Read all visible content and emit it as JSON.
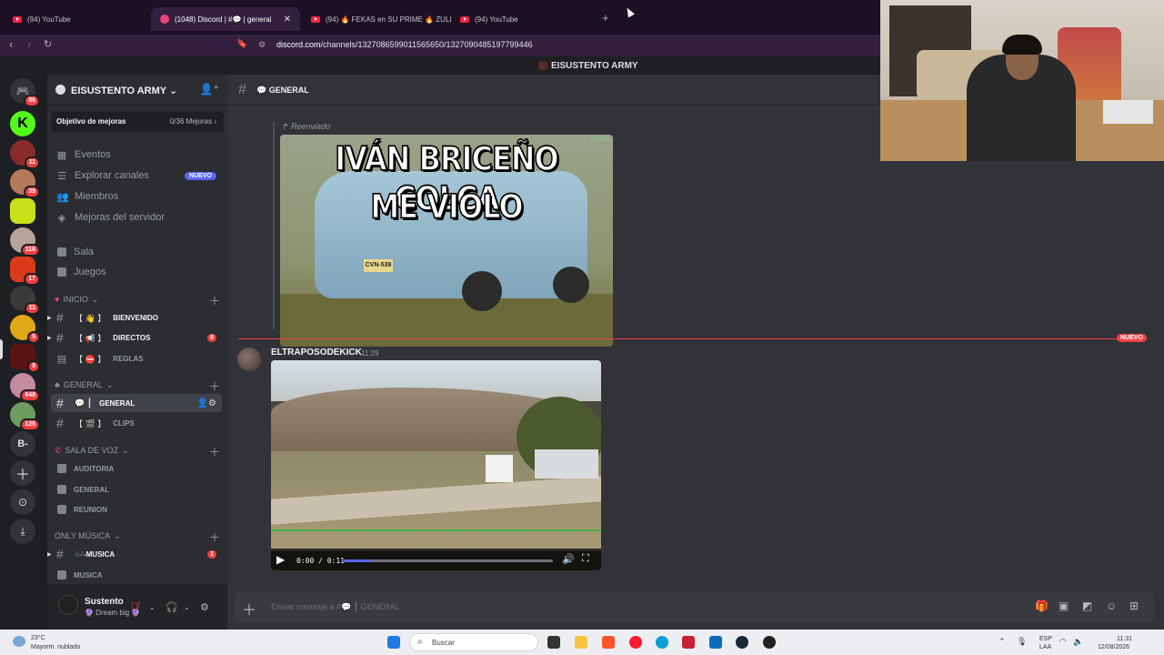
{
  "browser": {
    "tabs": [
      {
        "title": "(94) YouTube",
        "kind": "youtube"
      },
      {
        "title": "(1048) Discord | #💬 | general | E",
        "kind": "discord",
        "active": true
      },
      {
        "title": "(94) 🔥 FEKAS en SU PRIME 🔥 ZULLY",
        "kind": "youtube"
      },
      {
        "title": "(94) YouTube",
        "kind": "youtube"
      }
    ],
    "new_tab": "+",
    "url_host": "discord.com",
    "url_path": "/channels/1327086599011565650/1327090485197799446"
  },
  "discord": {
    "window_title": "EISUSTENTO ARMY",
    "guild_badges": [
      "86",
      "11",
      "39",
      "118",
      "17",
      "11",
      "5",
      "9",
      "648",
      "125"
    ],
    "guild_text": "B-",
    "server": {
      "name": "EISUSTENTO ARMY",
      "boost_label": "Objetivo de mejoras",
      "boost_value": "0/36 Mejoras",
      "menu": [
        {
          "label": "Eventos",
          "icon": "calendar-icon"
        },
        {
          "label": "Explorar canales",
          "icon": "browse-icon",
          "badge": "NUEVO"
        },
        {
          "label": "Miembros",
          "icon": "members-icon"
        },
        {
          "label": "Mejoras del servidor",
          "icon": "boost-icon"
        }
      ],
      "voice_top": [
        "Sala",
        "Juegos"
      ],
      "categories": {
        "inicio": "INICIO",
        "general": "GENERAL",
        "voz": "SALA DE VOZ",
        "musica": "ONLY MÚSICA"
      },
      "inicio_channels": [
        {
          "name": "bienvenido",
          "bracket": "【 👋 】",
          "type": "text"
        },
        {
          "name": "directos",
          "bracket": "【 📢 】",
          "type": "text",
          "badge": "8"
        },
        {
          "name": "reglas",
          "bracket": "【 ⛔ 】",
          "type": "rules"
        }
      ],
      "general_channels": [
        {
          "name": "general",
          "bracket": "💬 ┃",
          "selected": true
        },
        {
          "name": "clips",
          "bracket": "【 🎬 】"
        }
      ],
      "voice_channels": [
        "AUDITORIA",
        "GENERAL",
        "REUNION"
      ],
      "music_channels": [
        {
          "name": "🎶-musica",
          "badge": "1",
          "type": "text"
        },
        {
          "name": "MUSICA",
          "type": "voice"
        }
      ]
    },
    "user": {
      "name": "Sustento",
      "status": "🔮 Dream big 🔮"
    },
    "channel": {
      "name": "💬 GENERAL"
    },
    "forwarded_label": "Reenviado",
    "meme": {
      "line1": "IVÁN BRICEÑO COLCA",
      "line2": "ME VIOLO",
      "plate": "CVN-539",
      "corner": "HORA"
    },
    "new_divider": "NUEVO",
    "message": {
      "author": "ELTRAPOSODEKICK",
      "time": "11:29"
    },
    "video": {
      "time": "0:00 / 0:11",
      "progress": 0.13
    },
    "composer": {
      "placeholder": "Enviar mensaje a #💬 ┃ GENERAL"
    }
  },
  "taskbar": {
    "temp": "23°C",
    "weather": "Mayorm. nublado",
    "search": "Buscar",
    "lang1": "ESP",
    "lang2": "LAA",
    "time": "11:31",
    "date": "12/08/2026"
  }
}
